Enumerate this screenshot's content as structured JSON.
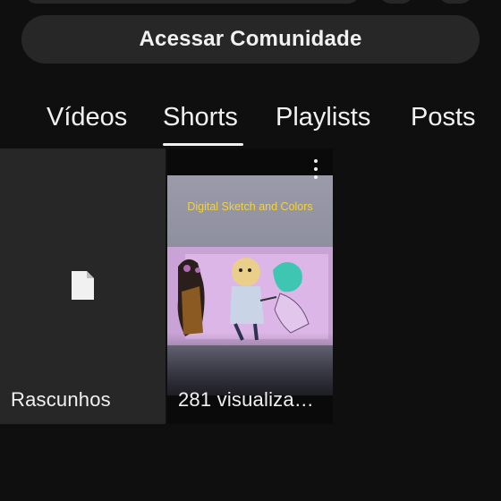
{
  "community": {
    "button_label": "Acessar Comunidade"
  },
  "tabs": [
    {
      "label": "Vídeos",
      "selected": false
    },
    {
      "label": "Shorts",
      "selected": true
    },
    {
      "label": "Playlists",
      "selected": false
    },
    {
      "label": "Posts",
      "selected": false
    }
  ],
  "drafts": {
    "label": "Rascunhos",
    "icon": "document-icon"
  },
  "short": {
    "thumbnail_title": "Digital Sketch and Colors",
    "views_label": "281 visualiza…",
    "menu_icon": "more-vert-icon"
  },
  "colors": {
    "background": "#0f0f0f",
    "surface": "#272727",
    "text": "#f1f1f1",
    "thumbnail_title": "#f2d23a"
  }
}
